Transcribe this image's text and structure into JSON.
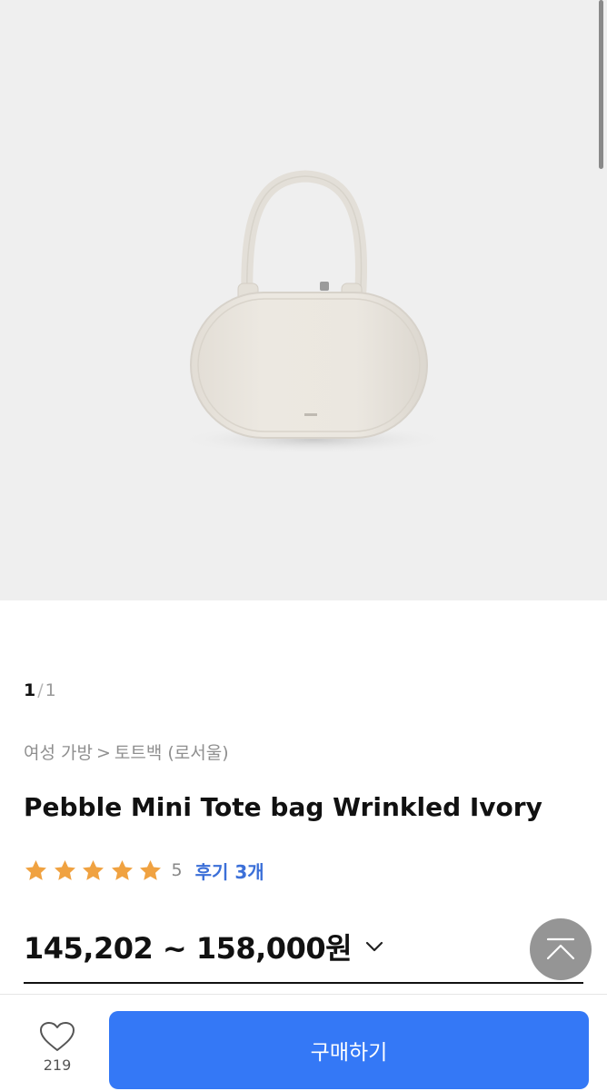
{
  "pager": {
    "current": "1",
    "separator": "/",
    "total": "1"
  },
  "breadcrumb": {
    "category": "여성 가방",
    "sep": ">",
    "sub": "토트백 (로서울)"
  },
  "product": {
    "title": "Pebble Mini Tote bag Wrinkled Ivory",
    "rating": "5",
    "reviews_label": "후기 3개",
    "price": "145,202 ~ 158,000원"
  },
  "bottom": {
    "like_count": "219",
    "buy_label": "구매하기"
  },
  "colors": {
    "accent": "#3478f6",
    "star": "#f0a241",
    "review_link": "#3b6fd8"
  },
  "icons": [
    "heart-icon",
    "chevron-down-icon",
    "scroll-top-icon",
    "star-icon"
  ]
}
